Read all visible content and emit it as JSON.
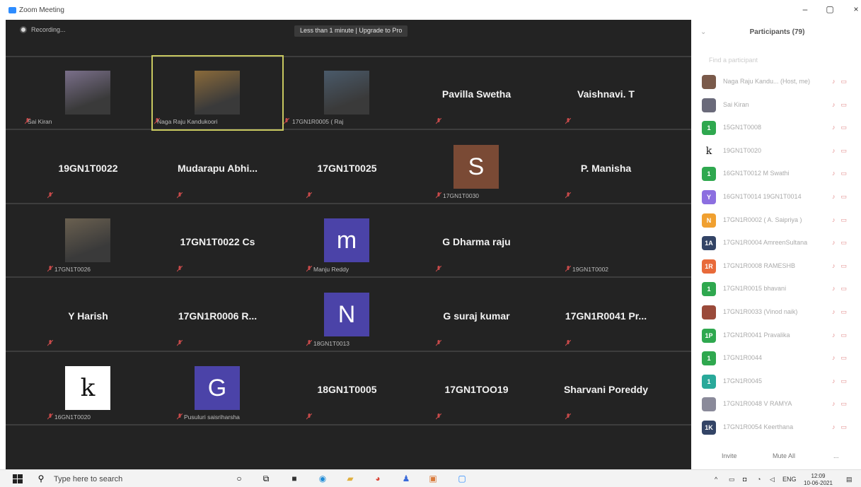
{
  "window": {
    "title": "Zoom Meeting",
    "minimize": "–",
    "maximize": "▢",
    "close": "×"
  },
  "meeting": {
    "recording_label": "Recording...",
    "upgrade_banner": "Less than 1 minute | Upgrade to Pro"
  },
  "tiles": [
    {
      "kind": "photo",
      "label": "Sai Kiran",
      "photo": "person-photo-1",
      "color": "#7a6f8a"
    },
    {
      "kind": "photo",
      "label": "Naga Raju Kandukoori",
      "photo": "person-photo-2",
      "color": "#8a6a3a",
      "active": true
    },
    {
      "kind": "photo",
      "label": "17GN1R0005 ( Raj",
      "photo": "person-photo-3",
      "color": "#4a5a6a"
    },
    {
      "kind": "name",
      "name": "Pavilla Swetha"
    },
    {
      "kind": "name",
      "name": "Vaishnavi. T"
    },
    {
      "kind": "name",
      "name": "19GN1T0022"
    },
    {
      "kind": "name",
      "name": "Mudarapu  Abhi..."
    },
    {
      "kind": "name",
      "name": "17GN1T0025"
    },
    {
      "kind": "letter",
      "letter": "S",
      "label": "17GN1T0030",
      "color": "#7a4a35"
    },
    {
      "kind": "name",
      "name": "P. Manisha"
    },
    {
      "kind": "photo",
      "label": "17GN1T0026",
      "photo": "bird-photo",
      "color": "#6a6050"
    },
    {
      "kind": "name",
      "name": "17GN1T0022 Cs"
    },
    {
      "kind": "letter",
      "letter": "m",
      "label": "Manju Reddy",
      "color": "#4b43a8"
    },
    {
      "kind": "name",
      "name": "G Dharma raju"
    },
    {
      "kind": "blank",
      "label": "19GN1T0002"
    },
    {
      "kind": "name",
      "name": "Y Harish"
    },
    {
      "kind": "name",
      "name": "17GN1R0006  R..."
    },
    {
      "kind": "letter",
      "letter": "N",
      "label": "18GN1T0013",
      "color": "#4b43a8"
    },
    {
      "kind": "name",
      "name": "G suraj kumar"
    },
    {
      "kind": "name",
      "name": "17GN1R0041  Pr..."
    },
    {
      "kind": "letter-white",
      "letter": "k",
      "label": "16GN1T0020",
      "color": "#ffffff"
    },
    {
      "kind": "letter",
      "letter": "G",
      "label": "Pusuluri saisriharsha",
      "color": "#4b43a8"
    },
    {
      "kind": "name",
      "name": "18GN1T0005"
    },
    {
      "kind": "name",
      "name": "17GN1TOO19"
    },
    {
      "kind": "name",
      "name": "Sharvani Poreddy"
    }
  ],
  "sidebar": {
    "title": "Participants (79)",
    "collapse": "⌄",
    "search_placeholder": "Find a participant",
    "participants": [
      {
        "avatar": "",
        "avatar_color": "#7a5a4a",
        "name": "Naga Raju Kandu...  (Host, me)"
      },
      {
        "avatar": "",
        "avatar_color": "#6a6a7a",
        "name": "Sai Kiran"
      },
      {
        "avatar": "1",
        "avatar_color": "#2fa84f",
        "name": "15GN1T0008"
      },
      {
        "avatar": "k",
        "avatar_color": "#ffffff",
        "name": "19GN1T0020"
      },
      {
        "avatar": "1",
        "avatar_color": "#2fa84f",
        "name": "16GN1T0012 M Swathi"
      },
      {
        "avatar": "Y",
        "avatar_color": "#8c6fe0",
        "name": "16GN1T0014 19GN1T0014"
      },
      {
        "avatar": "N",
        "avatar_color": "#f0a030",
        "name": "17GN1R0002 ( A. Saipriya )"
      },
      {
        "avatar": "1A",
        "avatar_color": "#334466",
        "name": "17GN1R0004 AmreenSultana"
      },
      {
        "avatar": "1R",
        "avatar_color": "#e86a3a",
        "name": "17GN1R0008 RAMESHB"
      },
      {
        "avatar": "1",
        "avatar_color": "#2fa84f",
        "name": "17GN1R0015 bhavani"
      },
      {
        "avatar": "",
        "avatar_color": "#9a4a3a",
        "name": "17GN1R0033 (Vinod naik)"
      },
      {
        "avatar": "1P",
        "avatar_color": "#2fa84f",
        "name": "17GN1R0041 Pravalika"
      },
      {
        "avatar": "1",
        "avatar_color": "#2fa84f",
        "name": "17GN1R0044"
      },
      {
        "avatar": "1",
        "avatar_color": "#29a99a",
        "name": "17GN1R0045"
      },
      {
        "avatar": "",
        "avatar_color": "#8a8a9a",
        "name": "17GN1R0048 V RAMYA"
      },
      {
        "avatar": "1K",
        "avatar_color": "#334466",
        "name": "17GN1R0054 Keerthana"
      }
    ],
    "invite_label": "Invite",
    "mute_all_label": "Mute All",
    "more_label": "..."
  },
  "taskbar": {
    "search_placeholder": "Type here to search",
    "language": "ENG",
    "time": "12:09",
    "date": "10-06-2021"
  },
  "colors": {
    "stage": "#232323",
    "accent": "#2d8cff",
    "muted": "#c84a4a"
  }
}
